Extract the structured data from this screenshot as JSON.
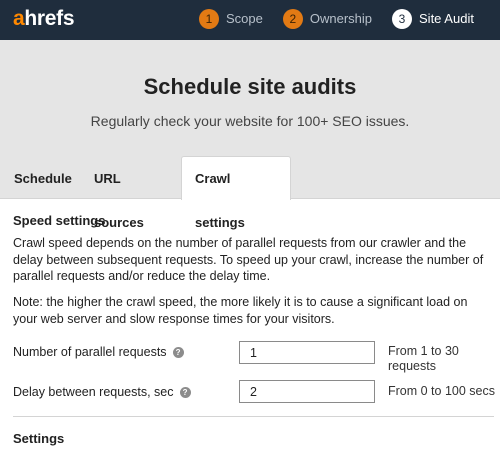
{
  "header": {
    "logo_a": "a",
    "logo_rest": "hrefs",
    "steps": [
      {
        "number": "1",
        "label": "Scope",
        "state": "done"
      },
      {
        "number": "2",
        "label": "Ownership",
        "state": "done"
      },
      {
        "number": "3",
        "label": "Site Audit",
        "state": "active"
      }
    ]
  },
  "hero": {
    "title": "Schedule site audits",
    "subtitle": "Regularly check your website for 100+ SEO issues."
  },
  "tabs": [
    {
      "label": "Schedule",
      "active": false
    },
    {
      "label": "URL sources",
      "active": false
    },
    {
      "label": "Crawl settings",
      "active": true
    }
  ],
  "speed_settings": {
    "title": "Speed settings",
    "description": "Crawl speed depends on the number of parallel requests from our crawler and the delay between subsequent requests. To speed up your crawl, increase the number of parallel requests and/or reduce the delay time.",
    "note": "Note: the higher the crawl speed, the more likely it is to cause a significant load on your web server and slow response times for your visitors.",
    "fields": [
      {
        "label": "Number of parallel requests",
        "value": "1",
        "hint": "From 1 to 30 requests"
      },
      {
        "label": "Delay between requests, sec",
        "value": "2",
        "hint": "From 0 to 100 secs"
      }
    ]
  },
  "settings": {
    "title": "Settings"
  },
  "colors": {
    "topbar": "#1f2d3d",
    "step_done": "#e27a14",
    "hero_bg": "#e5e5e5"
  }
}
